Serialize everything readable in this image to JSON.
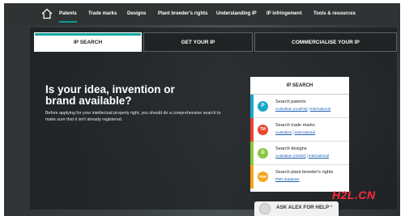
{
  "nav": {
    "items": [
      {
        "label": "Patents",
        "active": true
      },
      {
        "label": "Trade marks"
      },
      {
        "label": "Designs"
      },
      {
        "label": "Plant breeder's rights"
      },
      {
        "label": "Understanding IP"
      },
      {
        "label": "IP infringement"
      },
      {
        "label": "Tools & resources"
      }
    ]
  },
  "tabs": [
    {
      "label": "IP SEARCH",
      "active": true
    },
    {
      "label": "GET YOUR IP"
    },
    {
      "label": "COMMERCIALISE YOUR IP"
    }
  ],
  "hero": {
    "headline_line1": "Is your idea, invention or",
    "headline_line2": "brand available?",
    "subtext": "Before applying for your intellectual property right, you should do a comprehensive search to make sure that it isn't already registered."
  },
  "panel": {
    "title": "IP SEARCH",
    "rows": [
      {
        "icon": "P",
        "color": "#19a7c9",
        "title": "Search patents",
        "links": [
          "Australian (AusPat)",
          "International"
        ]
      },
      {
        "icon": "TM",
        "color": "#e8462d",
        "title": "Search trade marks",
        "links": [
          "Australian",
          "International"
        ]
      },
      {
        "icon": "D",
        "color": "#8cc63f",
        "title": "Search designs",
        "links": [
          "Australian (ADDS)",
          "International"
        ]
      },
      {
        "icon": "PBR",
        "color": "#f4a51d",
        "title": "Search plant breeder's rights",
        "links": [
          "PBR database"
        ]
      }
    ]
  },
  "help": {
    "label": "ASK ALEX FOR HELP"
  },
  "watermark": {
    "text": "H2L.CN"
  },
  "colors": {
    "accent": "#11a69f",
    "nav_bg": "#2f3334"
  }
}
